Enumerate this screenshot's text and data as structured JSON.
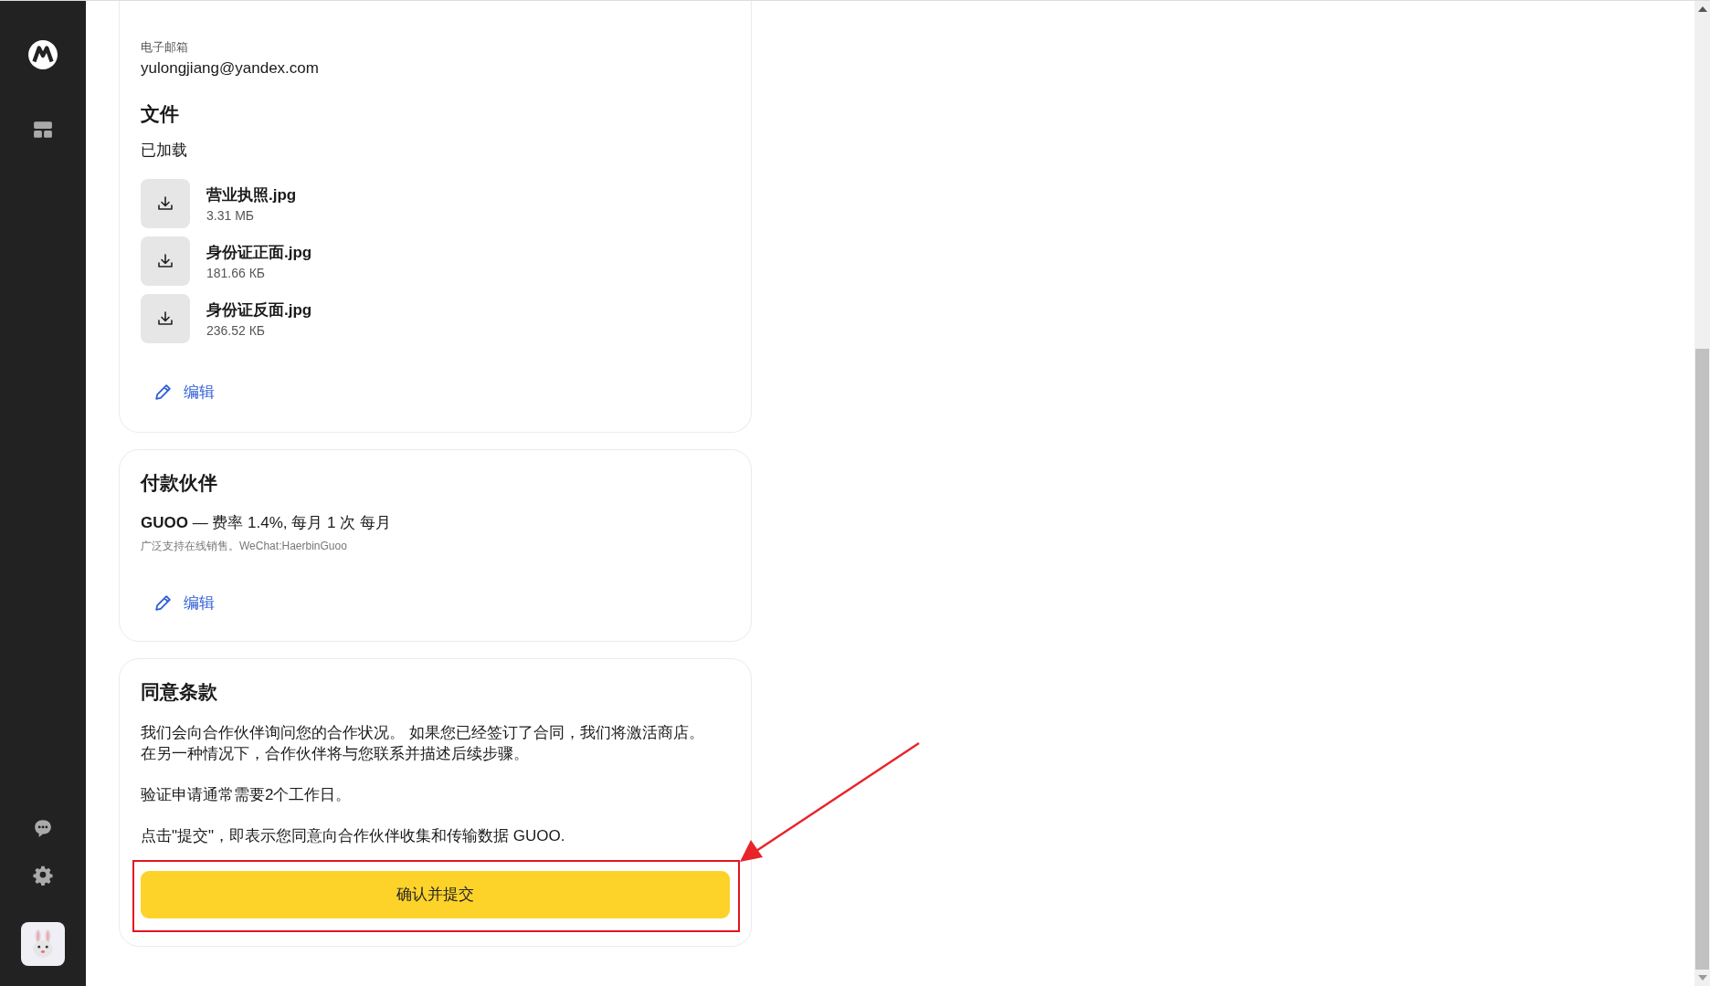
{
  "contact": {
    "email_label": "电子邮箱",
    "email": "yulongjiang@yandex.com"
  },
  "files": {
    "title": "文件",
    "status": "已加载",
    "items": [
      {
        "name": "营业执照.jpg",
        "size": "3.31 МБ"
      },
      {
        "name": "身份证正面.jpg",
        "size": "181.66 КБ"
      },
      {
        "name": "身份证反面.jpg",
        "size": "236.52 КБ"
      }
    ],
    "edit": "编辑"
  },
  "payment_partner": {
    "title": "付款伙伴",
    "partner_name": "GUOO",
    "terms": " — 费率 1.4%, 每月 1 次 每月",
    "note": "广泛支持在线销售。WeChat:HaerbinGuoo",
    "edit": "编辑"
  },
  "agreement": {
    "title": "同意条款",
    "paragraphs": [
      {
        "lines": [
          "我们会向合作伙伴询问您的合作状况。 如果您已经签订了合同，我们将激活商店。",
          "在另一种情况下，合作伙伴将与您联系并描述后续步骤。"
        ]
      },
      {
        "lines": [
          "验证申请通常需要2个工作日。"
        ]
      },
      {
        "lines": [
          "点击\"提交\"，即表示您同意向合作伙伴收集和传输数据 GUOO."
        ]
      }
    ],
    "submit": "确认并提交",
    "highlighted": true
  }
}
